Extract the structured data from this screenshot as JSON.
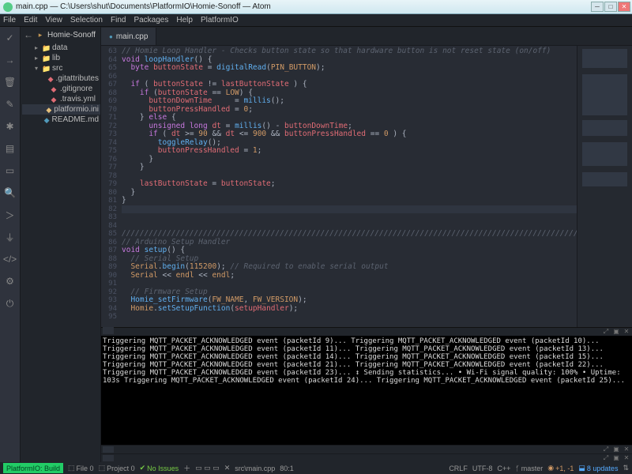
{
  "window": {
    "title": "main.cpp — C:\\Users\\shut\\Documents\\PlatformIO\\Homie-Sonoff — Atom"
  },
  "menubar": [
    "File",
    "Edit",
    "View",
    "Selection",
    "Find",
    "Packages",
    "Help",
    "PlatformIO"
  ],
  "sidebar": {
    "project": "Homie-Sonoff",
    "items": [
      {
        "label": "data",
        "type": "folder",
        "indent": 1,
        "expanded": false
      },
      {
        "label": "lib",
        "type": "folder",
        "indent": 1,
        "expanded": false
      },
      {
        "label": "src",
        "type": "folder-src",
        "indent": 1,
        "expanded": true
      },
      {
        "label": ".gitattributes",
        "type": "git",
        "indent": 2
      },
      {
        "label": ".gitignore",
        "type": "git",
        "indent": 2
      },
      {
        "label": ".travis.yml",
        "type": "yml",
        "indent": 2
      },
      {
        "label": "platformio.ini",
        "type": "plat",
        "indent": 2,
        "sel": true
      },
      {
        "label": "README.md",
        "type": "md",
        "indent": 2
      }
    ]
  },
  "tab": {
    "label": "main.cpp"
  },
  "gutter": [
    "63",
    "64",
    "65",
    "66",
    "67",
    "68",
    "69",
    "70",
    "71",
    "72",
    "73",
    "74",
    "75",
    "76",
    "77",
    "78",
    "79",
    "80",
    "81",
    "82",
    "83",
    "84",
    "85",
    "86",
    "87",
    "88",
    "89",
    "90",
    "91",
    "92",
    "93",
    "94",
    "95"
  ],
  "terminal_lines": [
    "Triggering MQTT_PACKET_ACKNOWLEDGED event (packetId 9)...",
    "Triggering MQTT_PACKET_ACKNOWLEDGED event (packetId 10)...",
    "Triggering MQTT_PACKET_ACKNOWLEDGED event (packetId 11)...",
    "Triggering MQTT_PACKET_ACKNOWLEDGED event (packetId 13)...",
    "Triggering MQTT_PACKET_ACKNOWLEDGED event (packetId 14)...",
    "Triggering MQTT_PACKET_ACKNOWLEDGED event (packetId 15)...",
    "Triggering MQTT_PACKET_ACKNOWLEDGED event (packetId 21)...",
    "Triggering MQTT_PACKET_ACKNOWLEDGED event (packetId 22)...",
    "Triggering MQTT_PACKET_ACKNOWLEDGED event (packetId 23)...",
    "↕ Sending statistics...",
    "  • Wi-Fi signal quality: 100%",
    "  • Uptime: 103s",
    "Triggering MQTT_PACKET_ACKNOWLEDGED event (packetId 24)...",
    "Triggering MQTT_PACKET_ACKNOWLEDGED event (packetId 25)..."
  ],
  "status": {
    "build": "PlatformIO: Build",
    "file": "File 0",
    "project": "Project 0",
    "issues": "No Issues",
    "path": "src\\main.cpp",
    "pos": "80:1",
    "crlf": "CRLF",
    "enc": "UTF-8",
    "lang": "C++",
    "branch": "master",
    "diff": "+1, -1",
    "updates": "8 updates"
  },
  "code_comment_top": "// Homie Loop Handler - Checks button state so that hardware button is not reset state (on/off)",
  "code": {
    "l1": "void loopHandler() {",
    "l2": "  byte buttonState = digitalRead(PIN_BUTTON);",
    "l3": "",
    "l4": "  if ( buttonState != lastButtonState ) {",
    "l5": "    if (buttonState == LOW) {",
    "l6": "      buttonDownTime     = millis();",
    "l7": "      buttonPressHandled = 0;",
    "l8": "    } else {",
    "l9": "      unsigned long dt = millis() - buttonDownTime;",
    "l10": "      if ( dt >= 90 && dt <= 900 && buttonPressHandled == 0 ) {",
    "l11": "        toggleRelay();",
    "l12": "        buttonPressHandled = 1;",
    "l13": "      }",
    "l14": "    }",
    "l15": "",
    "l16": "    lastButtonState = buttonState;",
    "l17": "  }",
    "l18": "}",
    "divider": "////////////////////////////////////////////////////////////////////////////////////////////////////////////////",
    "c_setup_hdr": "// Arduino Setup Handler",
    "s1": "void setup() {",
    "c_serial": "  // Serial Setup",
    "s2": "  Serial.begin(115200); // Required to enable serial output",
    "s3": "  Serial << endl << endl;",
    "c_fw": "  // Firmware Setup",
    "s4": "  Homie_setFirmware(FW_NAME, FW_VERSION);",
    "s5": "  Homie.setSetupFunction(setupHandler);"
  }
}
